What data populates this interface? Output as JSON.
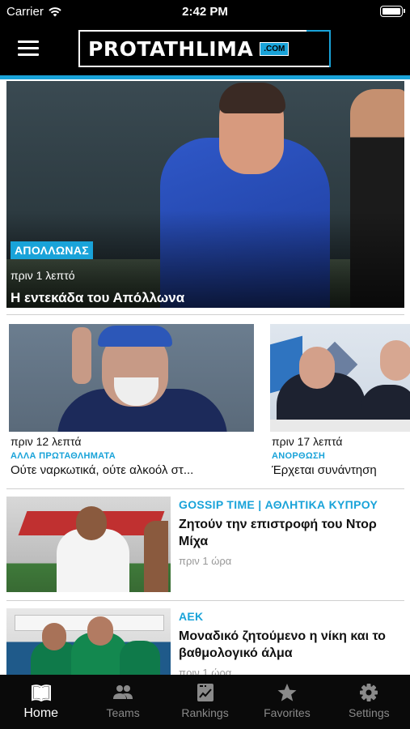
{
  "status_bar": {
    "carrier": "Carrier",
    "time": "2:42 PM"
  },
  "header": {
    "logo_text": "PROTATHLIMA",
    "logo_domain": ".COM"
  },
  "hero": {
    "category": "ΑΠΟΛΛΩΝΑΣ",
    "time": "πριν 1 λεπτό",
    "title": "Η εντεκάδα του Απόλλωνα"
  },
  "cards": [
    {
      "time": "πριν 12 λεπτά",
      "category": "ΑΛΛΑ ΠΡΩΤΑΘΛΗΜΑΤΑ",
      "title": "Ούτε ναρκωτικά, ούτε αλκοόλ στ..."
    },
    {
      "time": "πριν 17 λεπτά",
      "category": "ΑΝΟΡΘΩΣΗ",
      "title": "Έρχεται συνάντηση"
    }
  ],
  "rows": [
    {
      "category": "GOSSIP TIME | ΑΘΛΗΤΙΚΑ ΚΥΠΡΟΥ",
      "title": "Ζητούν την επιστροφή του Ντορ Μίχα",
      "time": "πριν 1 ώρα"
    },
    {
      "category": "ΑΕΚ",
      "title": "Μοναδικό ζητούμενο η νίκη και το βαθμολογικό άλμα",
      "time": "πριν 1 ώρα"
    }
  ],
  "tabs": [
    {
      "label": "Home",
      "icon": "book-icon",
      "active": true
    },
    {
      "label": "Teams",
      "icon": "people-icon",
      "active": false
    },
    {
      "label": "Rankings",
      "icon": "rankings-icon",
      "active": false
    },
    {
      "label": "Favorites",
      "icon": "star-icon",
      "active": false
    },
    {
      "label": "Settings",
      "icon": "gear-icon",
      "active": false
    }
  ],
  "colors": {
    "accent": "#19a3d9",
    "background": "#ffffff",
    "bars": "#000000"
  }
}
